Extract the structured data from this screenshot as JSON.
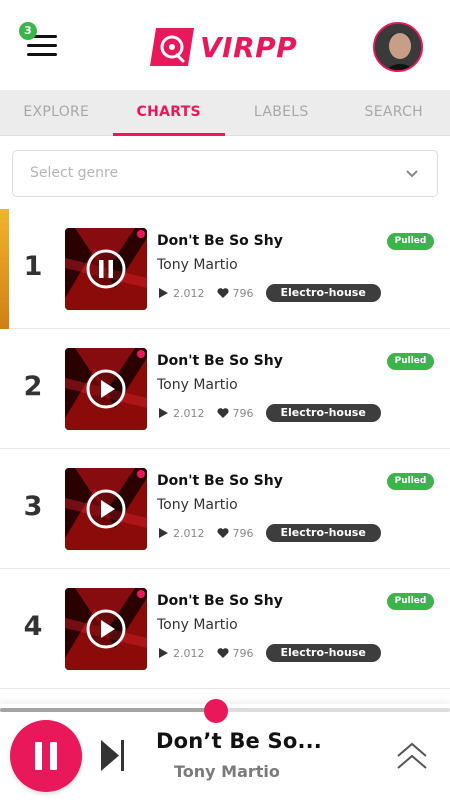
{
  "header": {
    "logo_text": "VIRPP",
    "notification_count": "3",
    "menu_icon": "hamburger-menu-icon",
    "avatar_icon": "user-avatar"
  },
  "tabs": [
    {
      "label": "EXPLORE",
      "active": false
    },
    {
      "label": "CHARTS",
      "active": true
    },
    {
      "label": "LABELS",
      "active": false
    },
    {
      "label": "SEARCH",
      "active": false
    }
  ],
  "genre_select": {
    "placeholder": "Select genre",
    "icon": "chevron-down-icon"
  },
  "chart": [
    {
      "rank": "1",
      "title": "Don't Be So Shy",
      "artist": "Tony Martio",
      "plays": "2.012",
      "likes": "796",
      "genre": "Electro-house",
      "badge": "Pulled",
      "state": "playing"
    },
    {
      "rank": "2",
      "title": "Don't Be So Shy",
      "artist": "Tony Martio",
      "plays": "2.012",
      "likes": "796",
      "genre": "Electro-house",
      "badge": "Pulled",
      "state": "paused"
    },
    {
      "rank": "3",
      "title": "Don't Be So Shy",
      "artist": "Tony Martio",
      "plays": "2.012",
      "likes": "796",
      "genre": "Electro-house",
      "badge": "Pulled",
      "state": "paused"
    },
    {
      "rank": "4",
      "title": "Don't Be So Shy",
      "artist": "Tony Martio",
      "plays": "2.012",
      "likes": "796",
      "genre": "Electro-house",
      "badge": "Pulled",
      "state": "paused"
    }
  ],
  "player": {
    "title": "Don’t Be So...",
    "artist": "Tony Martio",
    "progress": 0.48,
    "state": "playing"
  },
  "colors": {
    "accent": "#e8185a",
    "badge_green": "#39b54a",
    "rank_gold": "#f0b52e",
    "chip_dark": "#3d3d3d"
  }
}
